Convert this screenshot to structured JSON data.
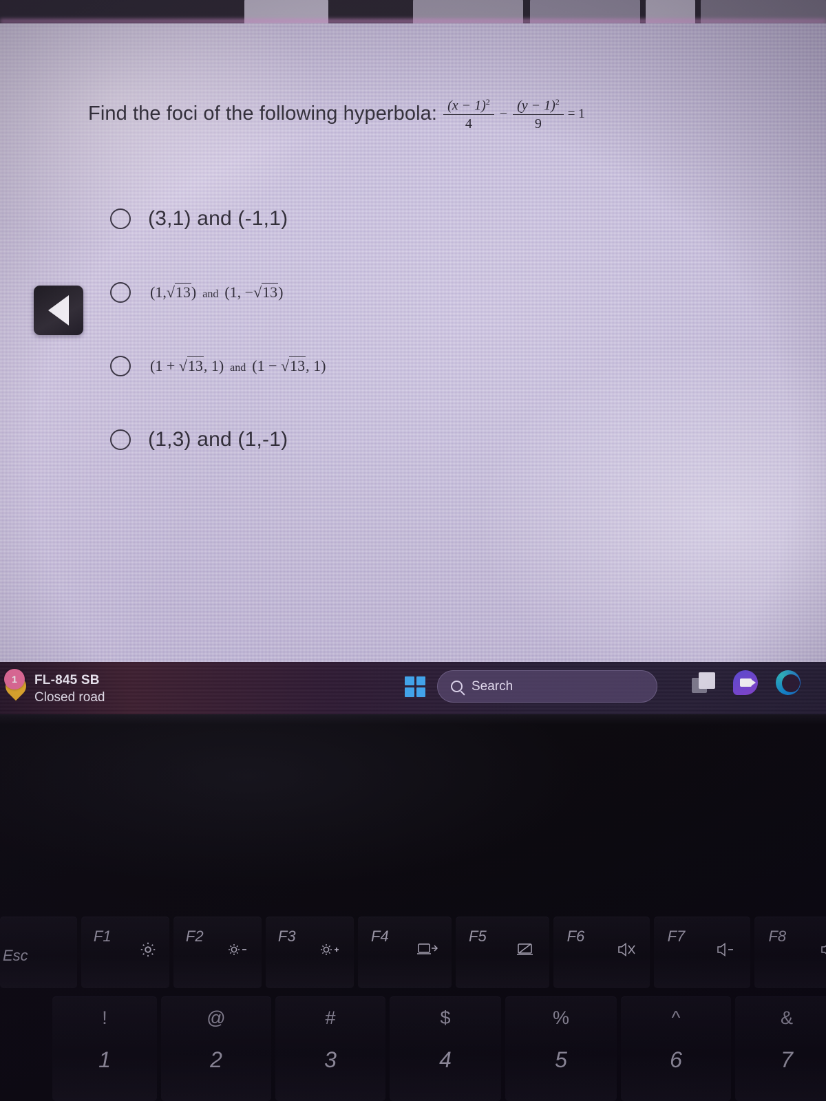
{
  "browser": {
    "tabs_visible": 5
  },
  "quiz": {
    "question_prefix": "Find the foci of the following hyperbola:",
    "equation": {
      "term1_numerator": "(x − 1)",
      "term1_exponent": "2",
      "term1_denominator": "4",
      "operator": "−",
      "term2_numerator": "(y − 1)",
      "term2_exponent": "2",
      "term2_denominator": "9",
      "equals": "= 1"
    },
    "options": [
      {
        "id": "option-a",
        "style": "plain",
        "text": "(3,1) and (-1,1)",
        "selected": false
      },
      {
        "id": "option-b",
        "style": "math",
        "left_expr_open": "(1,",
        "left_radicand": "13",
        "left_expr_close": ")",
        "conjunction": "and",
        "right_expr_open": "(1, −",
        "right_radicand": "13",
        "right_expr_close": ")",
        "text": "(1, √13) and (1, −√13)",
        "selected": false
      },
      {
        "id": "option-c",
        "style": "math",
        "left_expr_open": "(1 + ",
        "left_radicand": "13",
        "left_expr_close": ", 1)",
        "conjunction": "and",
        "right_expr_open": "(1 − ",
        "right_radicand": "13",
        "right_expr_close": ", 1)",
        "text": "(1 + √13, 1) and (1 − √13, 1)",
        "selected": false
      },
      {
        "id": "option-d",
        "style": "plain",
        "text": "(1,3) and (1,-1)",
        "selected": false
      }
    ]
  },
  "overlay": {
    "back_button_icon": "left-triangle"
  },
  "taskbar": {
    "notification": {
      "badge_count": "1",
      "title": "FL-845 SB",
      "subtitle": "Closed road",
      "pin_color": "#f0b429",
      "badge_color": "#ef6f9e"
    },
    "start_icon": "windows-logo",
    "search": {
      "placeholder": "Search",
      "icon": "search-icon"
    },
    "icons": [
      {
        "name": "task-view-icon",
        "label": "Task View"
      },
      {
        "name": "teams-icon",
        "label": "Microsoft Teams"
      },
      {
        "name": "edge-icon",
        "label": "Microsoft Edge"
      }
    ]
  },
  "keyboard": {
    "function_row": [
      {
        "key": "Esc",
        "glyph": "",
        "icon": ""
      },
      {
        "key": "F1",
        "glyph": "",
        "icon": "gear-icon"
      },
      {
        "key": "F2",
        "glyph": "−",
        "icon": "brightness-down-icon"
      },
      {
        "key": "F3",
        "glyph": "+",
        "icon": "brightness-up-icon"
      },
      {
        "key": "F4",
        "glyph": "",
        "icon": "display-switch-icon"
      },
      {
        "key": "F5",
        "glyph": "",
        "icon": "touchpad-toggle-icon"
      },
      {
        "key": "F6",
        "glyph": "",
        "icon": "mute-icon"
      },
      {
        "key": "F7",
        "glyph": "−",
        "icon": "volume-down-icon"
      },
      {
        "key": "F8",
        "glyph": "+",
        "icon": "volume-up-icon"
      }
    ],
    "number_row": [
      {
        "shift": "!",
        "base": "1"
      },
      {
        "shift": "@",
        "base": "2"
      },
      {
        "shift": "#",
        "base": "3"
      },
      {
        "shift": "$",
        "base": "4"
      },
      {
        "shift": "%",
        "base": "5"
      },
      {
        "shift": "^",
        "base": "6"
      },
      {
        "shift": "&",
        "base": "7"
      }
    ]
  },
  "colors": {
    "screen_bg": "#c9c2dd",
    "taskbar_bg": "#2b1730",
    "deck_bg": "#08070b",
    "text": "#2d2b35"
  }
}
